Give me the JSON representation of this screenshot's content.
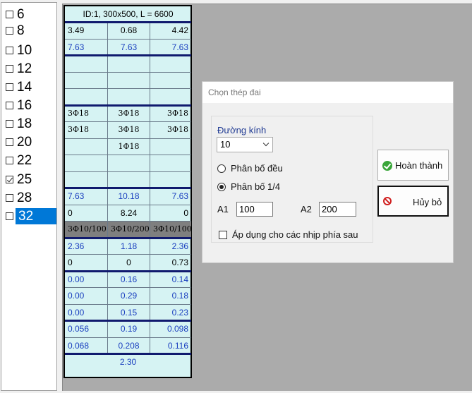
{
  "bar_list": {
    "items": [
      {
        "label": "6",
        "checked": false,
        "selected": false
      },
      {
        "label": "8",
        "checked": false,
        "selected": false
      },
      {
        "label": "10",
        "checked": false,
        "selected": false
      },
      {
        "label": "12",
        "checked": false,
        "selected": false
      },
      {
        "label": "14",
        "checked": false,
        "selected": false
      },
      {
        "label": "16",
        "checked": false,
        "selected": false
      },
      {
        "label": "18",
        "checked": false,
        "selected": false
      },
      {
        "label": "20",
        "checked": false,
        "selected": false
      },
      {
        "label": "22",
        "checked": false,
        "selected": false
      },
      {
        "label": "25",
        "checked": true,
        "selected": false
      },
      {
        "label": "28",
        "checked": false,
        "selected": false
      },
      {
        "label": "32",
        "checked": false,
        "selected": true
      }
    ]
  },
  "beam_table": {
    "header": "ID:1, 300x500, L = 6600",
    "rows": [
      [
        "3.49",
        "0.68",
        "4.42"
      ],
      [
        "7.63",
        "7.63",
        "7.63"
      ],
      [
        "",
        "",
        ""
      ],
      [
        "",
        "",
        ""
      ],
      [
        "",
        "",
        ""
      ],
      [
        "3Φ18",
        "3Φ18",
        "3Φ18"
      ],
      [
        "3Φ18",
        "3Φ18",
        "3Φ18"
      ],
      [
        "",
        "1Φ18",
        ""
      ],
      [
        "",
        "",
        ""
      ],
      [
        "",
        "",
        ""
      ],
      [
        "7.63",
        "10.18",
        "7.63"
      ],
      [
        "0",
        "8.24",
        "0"
      ],
      [
        "3Φ10/100",
        "3Φ10/200",
        "3Φ10/100"
      ],
      [
        "2.36",
        "1.18",
        "2.36"
      ],
      [
        "0",
        "0",
        "0.73"
      ],
      [
        "0.00",
        "0.16",
        "0.14"
      ],
      [
        "0.00",
        "0.29",
        "0.18"
      ],
      [
        "0.00",
        "0.15",
        "0.23"
      ],
      [
        "0.056",
        "0.19",
        "0.098"
      ],
      [
        "0.068",
        "0.208",
        "0.116"
      ]
    ],
    "footer": "2.30"
  },
  "dialog": {
    "title": "Chọn thép đai",
    "diameter_label": "Đường kính",
    "diameter_value": "10",
    "radio_uniform": "Phân bố đều",
    "radio_quarter": "Phân bố 1/4",
    "selected_distribution": "quarter",
    "a1_label": "A1",
    "a1_value": "100",
    "a2_label": "A2",
    "a2_value": "200",
    "apply_label": "Áp dụng cho các nhịp phía sau",
    "apply_checked": false,
    "complete_label": "Hoàn thành",
    "cancel_label": "Hủy bỏ"
  },
  "colors": {
    "table_bg": "#d6f3f3",
    "value_blue": "#1a3fbf",
    "separator_navy": "#101a6e",
    "stirrup_row_grey": "#7f7f7f",
    "selection_blue": "#0078d7"
  }
}
